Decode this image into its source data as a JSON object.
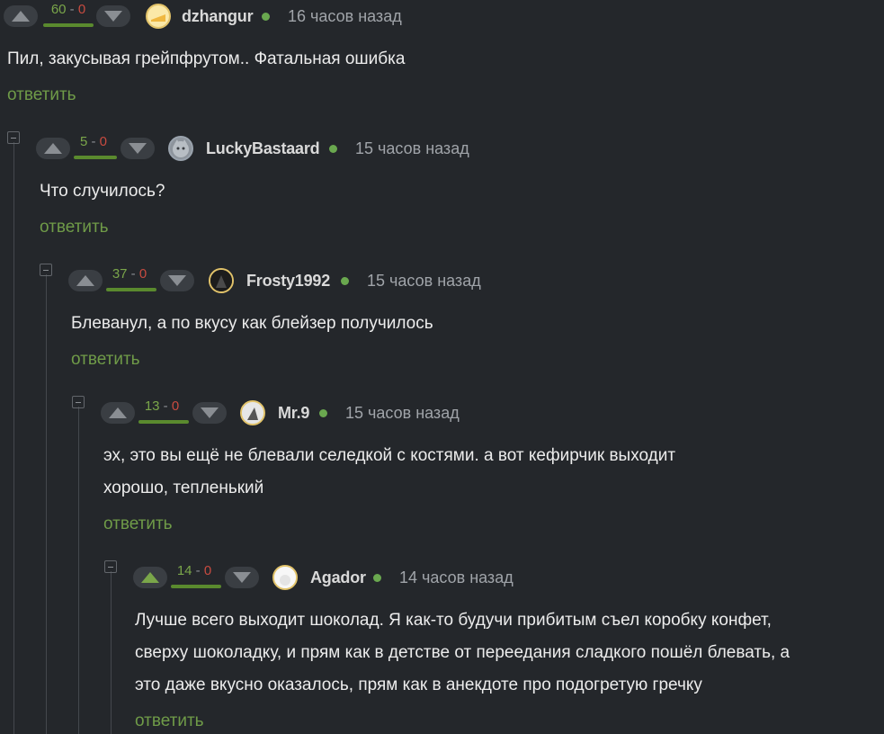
{
  "comments": [
    {
      "score_pos": "60",
      "score_sep": "-",
      "score_neg": "0",
      "username": "dzhangur",
      "time": "16 часов назад",
      "text_lines": [
        "Пил, закусывая грейпфрутом.. Фатальная ошибка"
      ],
      "reply": "ответить",
      "avatar_icon": "avatar-cheese-icon"
    },
    {
      "score_pos": "5",
      "score_sep": "-",
      "score_neg": "0",
      "username": "LuckyBastaard",
      "time": "15 часов назад",
      "text_lines": [
        "Что случилось?"
      ],
      "reply": "ответить",
      "avatar_icon": "avatar-cat-icon"
    },
    {
      "score_pos": "37",
      "score_sep": "-",
      "score_neg": "0",
      "username": "Frosty1992",
      "time": "15 часов назад",
      "text_lines": [
        "Блеванул, а по вкусу как блейзер получилось"
      ],
      "reply": "ответить",
      "avatar_icon": "avatar-dark-icon"
    },
    {
      "score_pos": "13",
      "score_sep": "-",
      "score_neg": "0",
      "username": "Mr.9",
      "time": "15 часов назад",
      "text_lines": [
        "эх, это вы ещё не блевали селедкой с костями. а вот кефирчик выходит",
        "хорошо, тепленький"
      ],
      "reply": "ответить",
      "avatar_icon": "avatar-figure-icon"
    },
    {
      "score_pos": "14",
      "score_sep": "-",
      "score_neg": "0",
      "username": "Agador",
      "time": "14 часов назад",
      "text_lines": [
        "Лучше всего выходит шоколад. Я как-то будучи прибитым съел коробку конфет,",
        "сверху шоколадку, и прям как в детстве от переедания сладкого пошёл блевать, а",
        "это даже вкусно оказалось, прям как в анекдоте про подогретую гречку"
      ],
      "reply": "ответить",
      "avatar_icon": "avatar-white-icon"
    }
  ],
  "colors": {
    "background": "#24272b",
    "positive": "#7aa64a",
    "negative": "#c84b40",
    "online": "#6aa84f",
    "reply": "#6f9b48"
  }
}
